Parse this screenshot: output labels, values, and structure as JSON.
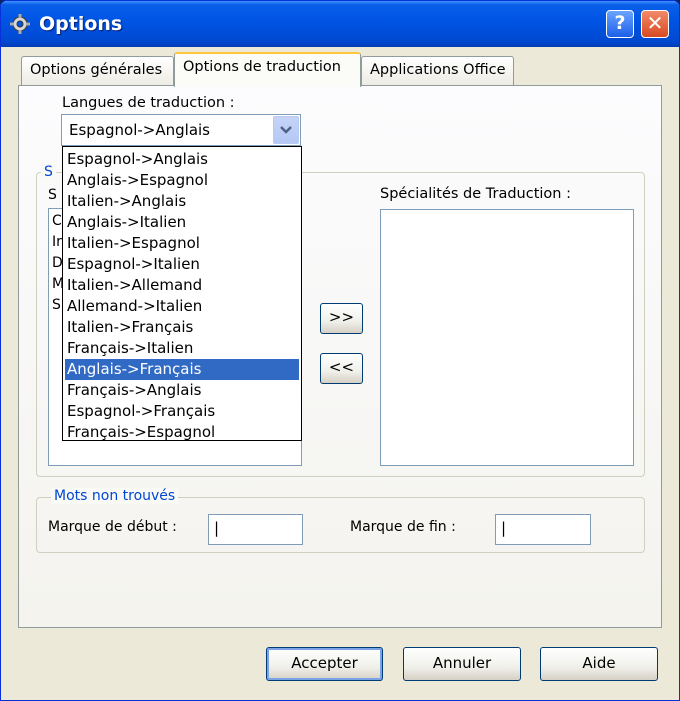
{
  "window": {
    "title": "Options",
    "help_glyph": "?",
    "close_glyph": "✕"
  },
  "tabs": [
    {
      "label": "Options générales"
    },
    {
      "label": "Options de traduction"
    },
    {
      "label": "Applications Office"
    }
  ],
  "translation": {
    "languages_label": "Langues de traduction :",
    "selected_language": "Espagnol->Anglais",
    "dropdown_options": [
      "Espagnol->Anglais",
      "Anglais->Espagnol",
      "Italien->Anglais",
      "Anglais->Italien",
      "Italien->Espagnol",
      "Espagnol->Italien",
      "Italien->Allemand",
      "Allemand->Italien",
      "Italien->Français",
      "Français->Italien",
      "Anglais->Français",
      "Français->Anglais",
      "Espagnol->Français",
      "Français->Espagnol"
    ],
    "highlighted_option": "Anglais->Français",
    "specialties_legend_partial": "S",
    "available_label_partial": "S",
    "available_items_partial": [
      "C",
      "Ir",
      "D",
      "M",
      "S"
    ],
    "specialties_label": "Spécialités de Traduction :",
    "add_button": ">>",
    "remove_button": "<<"
  },
  "not_found": {
    "legend": "Mots non trouvés",
    "start_label": "Marque de début :",
    "start_value": "|",
    "end_label": "Marque de fin :",
    "end_value": "|"
  },
  "footer": {
    "accept": "Accepter",
    "cancel": "Annuler",
    "help": "Aide"
  },
  "colors": {
    "title_bar": "#0055e5",
    "accent_tab": "#ffc73c",
    "selection": "#316ac5",
    "legend_text": "#0046d5"
  }
}
